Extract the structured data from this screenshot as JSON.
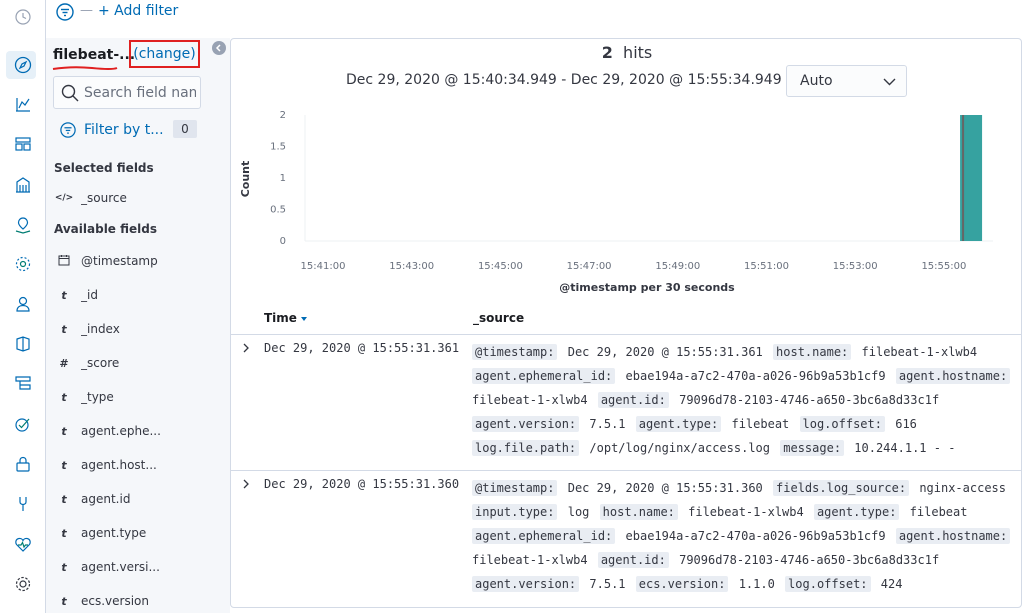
{
  "colors": {
    "accent": "#006bb4",
    "highlight": "#e02020",
    "bar": "#36a2a0",
    "nav_active": "#e6f0f8"
  },
  "nav": {
    "items": [
      {
        "icon": "clock-icon"
      },
      {
        "icon": "compass-icon",
        "active": true
      },
      {
        "icon": "visualize-icon"
      },
      {
        "icon": "dashboard-icon"
      },
      {
        "icon": "canvas-icon"
      },
      {
        "icon": "maps-icon"
      },
      {
        "icon": "ml-icon"
      },
      {
        "icon": "infrastructure-icon"
      },
      {
        "icon": "logs-icon"
      },
      {
        "icon": "apm-icon"
      },
      {
        "icon": "uptime-icon"
      },
      {
        "icon": "siem-icon"
      },
      {
        "icon": "dev-tools-icon"
      },
      {
        "icon": "monitoring-icon"
      },
      {
        "icon": "management-icon"
      }
    ]
  },
  "filter_bar": {
    "dash": "—",
    "add_filter": "+ Add filter"
  },
  "sidebar": {
    "index_pattern": "filebeat-...",
    "change": "(change)",
    "search_placeholder": "Search field names",
    "filter_by_type": "Filter by t...",
    "filter_count": "0",
    "selected_title": "Selected fields",
    "selected_fields": [
      {
        "type": "</>",
        "name": "_source"
      }
    ],
    "available_title": "Available fields",
    "available_fields": [
      {
        "type": "cal",
        "name": "@timestamp"
      },
      {
        "type": "t",
        "name": "_id"
      },
      {
        "type": "t",
        "name": "_index"
      },
      {
        "type": "#",
        "name": "_score"
      },
      {
        "type": "t",
        "name": "_type"
      },
      {
        "type": "t",
        "name": "agent.ephe..."
      },
      {
        "type": "t",
        "name": "agent.host..."
      },
      {
        "type": "t",
        "name": "agent.id"
      },
      {
        "type": "t",
        "name": "agent.type"
      },
      {
        "type": "t",
        "name": "agent.versi..."
      },
      {
        "type": "t",
        "name": "ecs.version"
      }
    ]
  },
  "main": {
    "hits_count": "2",
    "hits_label": "hits",
    "time_range": "Dec 29, 2020 @ 15:40:34.949 - Dec 29, 2020 @ 15:55:34.949 —",
    "interval": "Auto"
  },
  "chart_data": {
    "type": "bar",
    "ylabel": "Count",
    "xlabel": "@timestamp per 30 seconds",
    "ylim": [
      0,
      2
    ],
    "yticks": [
      "2",
      "1.5",
      "1",
      "0.5",
      "0"
    ],
    "xticks": [
      "15:41:00",
      "15:43:00",
      "15:45:00",
      "15:47:00",
      "15:49:00",
      "15:51:00",
      "15:53:00",
      "15:55:00"
    ],
    "series": [
      {
        "x": [
          "15:55:30"
        ],
        "values": [
          2
        ]
      }
    ],
    "grid": false
  },
  "table": {
    "col_time": "Time",
    "col_source": "_source",
    "rows": [
      {
        "time": "Dec 29, 2020 @ 15:55:31.361",
        "fields": [
          [
            "@timestamp:",
            "Dec 29, 2020 @ 15:55:31.361"
          ],
          [
            "host.name:",
            "filebeat-1-xlwb4"
          ],
          [
            "agent.ephemeral_id:",
            "ebae194a-a7c2-470a-a026-96b9a53b1cf9"
          ],
          [
            "agent.hostname:",
            "filebeat-1-xlwb4"
          ],
          [
            "agent.id:",
            "79096d78-2103-4746-a650-3bc6a8d33c1f"
          ],
          [
            "agent.version:",
            "7.5.1"
          ],
          [
            "agent.type:",
            "filebeat"
          ],
          [
            "log.offset:",
            "616"
          ],
          [
            "log.file.path:",
            "/opt/log/nginx/access.log"
          ],
          [
            "message:",
            "10.244.1.1 - -"
          ]
        ]
      },
      {
        "time": "Dec 29, 2020 @ 15:55:31.360",
        "fields": [
          [
            "@timestamp:",
            "Dec 29, 2020 @ 15:55:31.360"
          ],
          [
            "fields.log_source:",
            "nginx-access"
          ],
          [
            "input.type:",
            "log"
          ],
          [
            "host.name:",
            "filebeat-1-xlwb4"
          ],
          [
            "agent.type:",
            "filebeat"
          ],
          [
            "agent.ephemeral_id:",
            "ebae194a-a7c2-470a-a026-96b9a53b1cf9"
          ],
          [
            "agent.hostname:",
            "filebeat-1-xlwb4"
          ],
          [
            "agent.id:",
            "79096d78-2103-4746-a650-3bc6a8d33c1f"
          ],
          [
            "agent.version:",
            "7.5.1"
          ],
          [
            "ecs.version:",
            "1.1.0"
          ],
          [
            "log.offset:",
            "424"
          ]
        ]
      }
    ]
  }
}
